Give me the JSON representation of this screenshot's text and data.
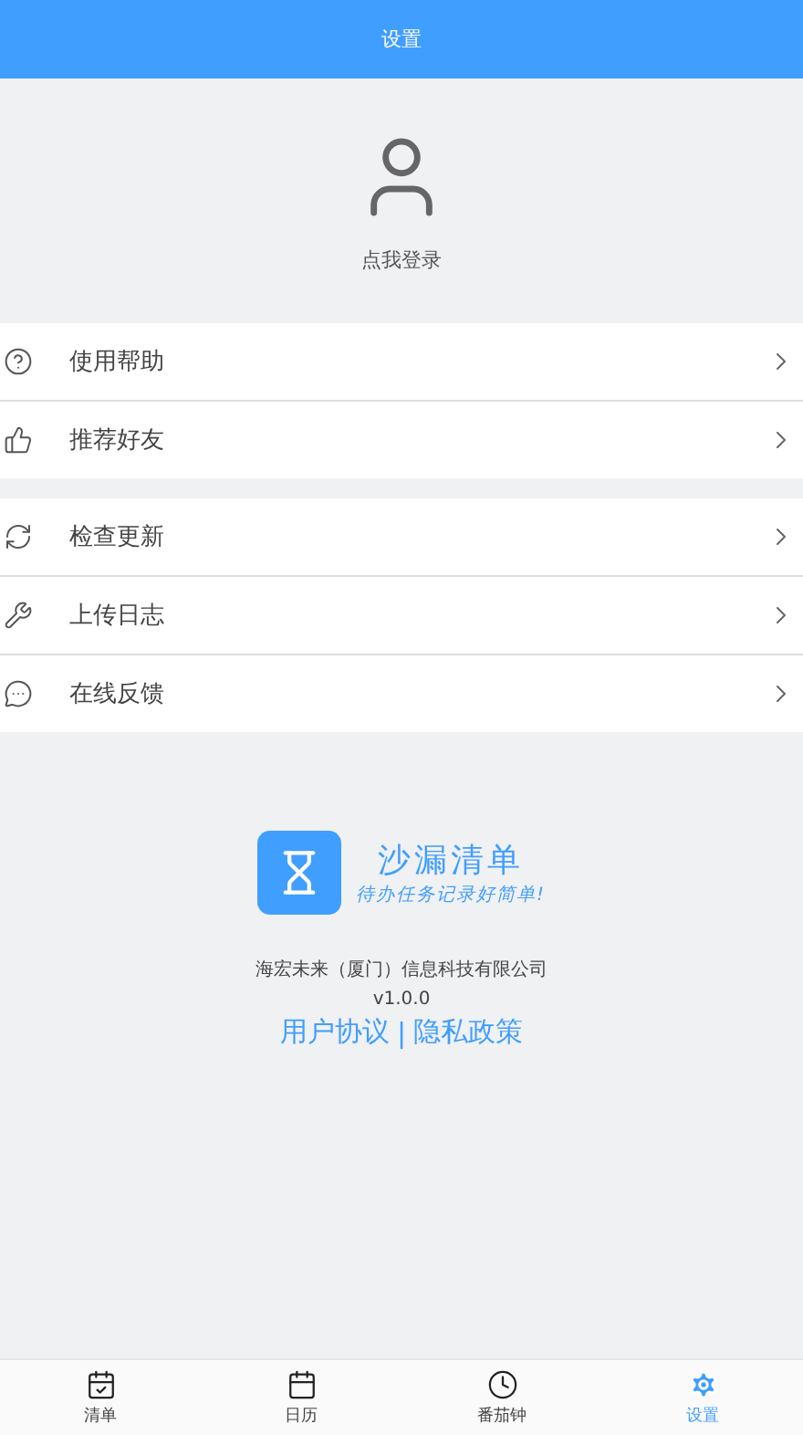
{
  "header": {
    "title": "设置"
  },
  "profile": {
    "label": "点我登录"
  },
  "menu_groups": [
    {
      "items": [
        {
          "kind": "help",
          "label": "使用帮助"
        },
        {
          "kind": "recommend",
          "label": "推荐好友"
        }
      ]
    },
    {
      "items": [
        {
          "kind": "update",
          "label": "检查更新"
        },
        {
          "kind": "log",
          "label": "上传日志"
        },
        {
          "kind": "feedback",
          "label": "在线反馈"
        }
      ]
    }
  ],
  "about": {
    "app_name": "沙漏清单",
    "slogan": "待办任务记录好简单!",
    "company": "海宏未来（厦门）信息科技有限公司",
    "version": "v1.0.0",
    "links": [
      "用户协议",
      "隐私政策"
    ],
    "link_separator": "|"
  },
  "tab_bar": [
    {
      "kind": "list",
      "label": "清单",
      "selected": false
    },
    {
      "kind": "calendar",
      "label": "日历",
      "selected": false
    },
    {
      "kind": "pomodoro",
      "label": "番茄钟",
      "selected": false
    },
    {
      "kind": "settings",
      "label": "设置",
      "selected": true
    }
  ]
}
